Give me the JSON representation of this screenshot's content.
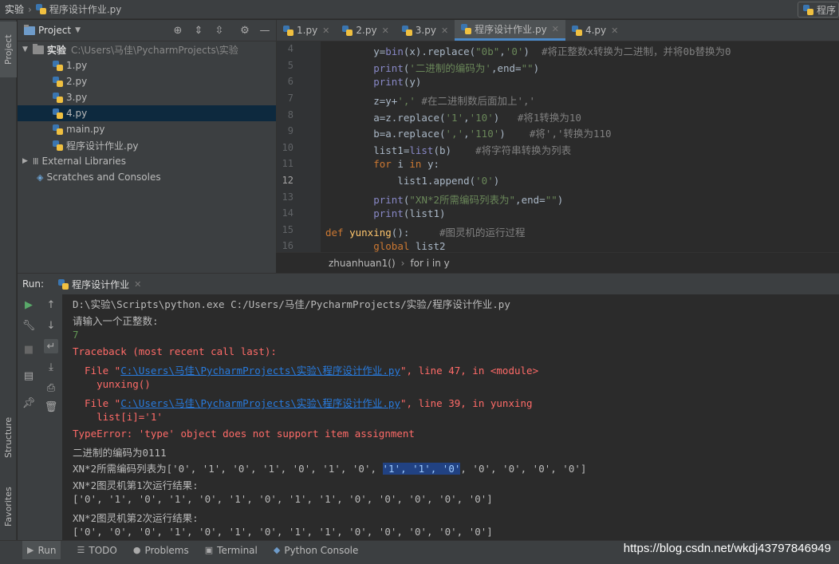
{
  "navbar": {
    "project": "实验",
    "file": "程序设计作业.py",
    "right_label": "程序"
  },
  "left_stripe": {
    "project": "Project",
    "structure": "Structure",
    "favorites": "Favorites"
  },
  "project_panel": {
    "title": "Project",
    "root": {
      "name": "实验",
      "path": "C:\\Users\\马佳\\PycharmProjects\\实验"
    },
    "files": [
      "1.py",
      "2.py",
      "3.py",
      "4.py",
      "main.py",
      "程序设计作业.py"
    ],
    "selected": "4.py",
    "external": "External Libraries",
    "scratches": "Scratches and Consoles"
  },
  "tabs": [
    {
      "label": "1.py",
      "active": false
    },
    {
      "label": "2.py",
      "active": false
    },
    {
      "label": "3.py",
      "active": false
    },
    {
      "label": "程序设计作业.py",
      "active": true
    },
    {
      "label": "4.py",
      "active": false
    }
  ],
  "editor": {
    "line_numbers": [
      "4",
      "5",
      "6",
      "7",
      "8",
      "9",
      "10",
      "11",
      "12",
      "13",
      "14",
      "15",
      "16"
    ],
    "lines": [
      "        y=bin(x).replace(\"0b\",'0')  #将正整数x转换为二进制，并将0b替换为0",
      "        print('二进制的编码为',end=\"\")",
      "        print(y)",
      "        z=y+',' #在二进制数后面加上','",
      "        a=z.replace('1','10')   #将1转换为10",
      "        b=a.replace(',','110')    #将','转换为110",
      "        list1=list(b)    #将字符串转换为列表",
      "        for i in y:",
      "            list1.append('0')",
      "        print(\"XN*2所需编码列表为\",end=\"\")",
      "        print(list1)",
      "def yunxing():     #图灵机的运行过程",
      "        global list2"
    ],
    "breadcrumb": [
      "zhuanhuan1()",
      "for i in y"
    ]
  },
  "run": {
    "label": "Run:",
    "config": "程序设计作业",
    "console": {
      "cmd": "D:\\实验\\Scripts\\python.exe C:/Users/马佳/PycharmProjects/实验/程序设计作业.py",
      "prompt": "请输入一个正整数:",
      "input": "7",
      "traceback": "Traceback (most recent call last):",
      "file_prefix": "  File \"",
      "file_path": "C:\\Users\\马佳\\PycharmProjects\\实验\\程序设计作业.py",
      "frame1_suffix": "\", line 47, in <module>",
      "frame1_code": "    yunxing()",
      "frame2_suffix": "\", line 39, in yunxing",
      "frame2_code": "    list[i]='1'",
      "error": "TypeError: 'type' object does not support item assignment",
      "binary": "二进制的编码为0111",
      "list_prefix": "XN*2所需编码列表为['0', '1', '0', '1', '0', '1', '0', ",
      "list_highlight": "'1', '1', '0'",
      "list_suffix": ", '0', '0', '0', '0']",
      "run1_title": "XN*2图灵机第1次运行结果:",
      "run1": "['0', '1', '0', '1', '0', '1', '0', '1', '1', '0', '0', '0', '0', '0']",
      "run2_title": "XN*2图灵机第2次运行结果:",
      "run2": "['0', '0', '0', '1', '0', '1', '0', '1', '1', '0', '0', '0', '0', '0']"
    }
  },
  "bottom": {
    "run": "Run",
    "todo": "TODO",
    "problems": "Problems",
    "terminal": "Terminal",
    "python_console": "Python Console",
    "watermark": "https://blog.csdn.net/wkdj43797846949"
  },
  "colors": {
    "selection": "#0d293e",
    "accent": "#4a88c7",
    "error": "#ff6b68",
    "link": "#287bde"
  }
}
